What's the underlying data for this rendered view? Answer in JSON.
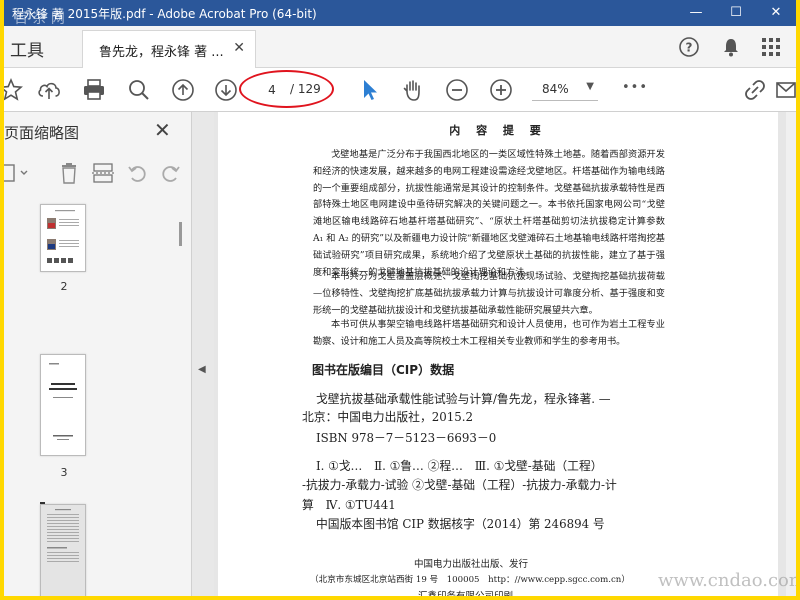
{
  "window": {
    "title": "程永锋 著 2015年版.pdf - Adobe Acrobat Pro (64-bit)",
    "minimize": "—",
    "maximize": "☐",
    "close": "✕"
  },
  "tabs": {
    "tools_label": "工具",
    "doc_tab_label": "鲁先龙，程永锋 著 ...",
    "doc_tab_close": "✕"
  },
  "toolbar": {
    "page_current": "4",
    "page_total": "/ 129",
    "zoom": "84%",
    "zoom_caret": "▼",
    "more": "•••"
  },
  "panel": {
    "title": "页面缩略图",
    "close": "✕",
    "thumb_labels": [
      "2",
      "3"
    ]
  },
  "document": {
    "heading": "内 容 提 要",
    "para1": "戈壁地基是广泛分布于我国西北地区的一类区域性特殊土地基。随着西部资源开发和经济的快速发展，越来越多的电网工程建设需途经戈壁地区。杆塔基础作为输电线路的一个重要组成部分，抗拔性能通常是其设计的控制条件。戈壁基础抗拔承载特性是西部特殊土地区电网建设中亟待研究解决的关键问题之一。本书依托国家电网公司“戈壁滩地区输电线路碎石地基杆塔基础研究”、“原状土杆塔基础剪切法抗拔稳定计算参数 A₁ 和 A₂ 的研究”以及新疆电力设计院“新疆地区戈壁滩碎石土地基输电线路杆塔掏挖基础试验研究”项目研究成果，系统地介绍了戈壁原状土基础的抗拔性能，建立了基于强度和变形统一的戈壁地基抗拔基础的设计理论和方法。",
    "para2": "本书共分为戈壁覆盖层概述、戈壁掏挖基础抗拔现场试验、戈壁掏挖基础抗拔荷载—位移特性、戈壁掏挖扩底基础抗拔承载力计算与抗拔设计可靠度分析、基于强度和变形统一的戈壁基础抗拔设计和戈壁抗拔基础承载性能研究展望共六章。",
    "para3": "本书可供从事架空输电线路杆塔基础研究和设计人员使用，也可作为岩土工程专业勘察、设计和施工人员及高等院校土木工程相关专业教师和学生的参考用书。",
    "cip_title": "图书在版编目（CIP）数据",
    "cip_line1": "戈壁抗拔基础承载性能试验与计算/鲁先龙，程永锋著. —",
    "cip_line2": "北京：中国电力出版社，2015.2",
    "cip_line3": "ISBN 978－7－5123－6693－0",
    "cip_line4": "Ⅰ. ①戈…　Ⅱ. ①鲁…  ②程…　Ⅲ. ①戈壁-基础（工程）",
    "cip_line5": "-抗拔力-承载力-试验  ②戈壁-基础（工程）-抗拔力-承载力-计",
    "cip_line6": "算　Ⅳ. ①TU441",
    "cip_line7": "中国版本图书馆 CIP 数据核字（2014）第 246894 号",
    "publisher": "中国电力出版社出版、发行",
    "address": "（北京市东城区北京站西街 19 号　100005　http：//www.cepp.sgcc.com.cn）",
    "printer": "汇鑫印务有限公司印刷"
  },
  "watermark": {
    "top_left": "百 杂 网",
    "bottom_right": "www.cndao.com"
  },
  "colors": {
    "accent_red": "#e0141e",
    "titlebar": "#2b579a",
    "select_blue": "#2d7fd3"
  }
}
